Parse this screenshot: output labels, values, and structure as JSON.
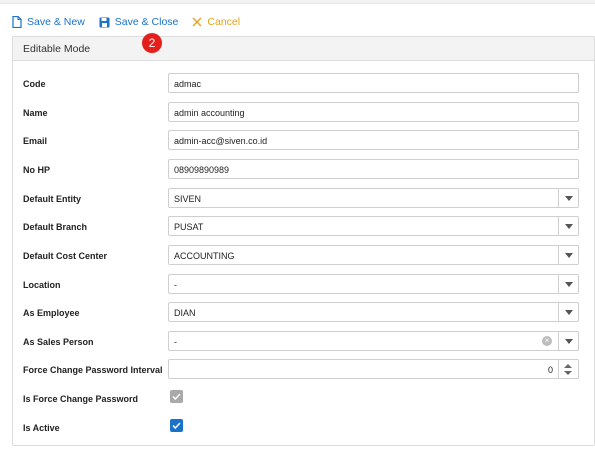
{
  "toolbar": {
    "save_new": "Save & New",
    "save_close": "Save & Close",
    "cancel": "Cancel"
  },
  "badge": "2",
  "panel": {
    "title": "Editable Mode"
  },
  "form": {
    "code": {
      "label": "Code",
      "value": "admac"
    },
    "name": {
      "label": "Name",
      "value": "admin accounting"
    },
    "email": {
      "label": "Email",
      "value": "admin-acc@siven.co.id"
    },
    "no_hp": {
      "label": "No HP",
      "value": "08909890989"
    },
    "default_entity": {
      "label": "Default Entity",
      "value": "SIVEN"
    },
    "default_branch": {
      "label": "Default Branch",
      "value": "PUSAT"
    },
    "default_cost_center": {
      "label": "Default Cost Center",
      "value": "ACCOUNTING"
    },
    "location": {
      "label": "Location",
      "value": "-"
    },
    "as_employee": {
      "label": "As Employee",
      "value": "DIAN"
    },
    "as_sales_person": {
      "label": "As Sales Person",
      "value": "-"
    },
    "force_change_password_interval": {
      "label": "Force Change Password Interval",
      "value": "0"
    },
    "is_force_change_password": {
      "label": "Is Force Change Password",
      "checked": true,
      "disabled": true
    },
    "is_active": {
      "label": "Is Active",
      "checked": true
    }
  },
  "colors": {
    "accent": "#1a73c9",
    "cancel": "#e3a41b",
    "badge": "#e3201b"
  },
  "icons": {
    "save_new": "document-icon",
    "save_close": "save-icon",
    "cancel": "close-icon"
  }
}
